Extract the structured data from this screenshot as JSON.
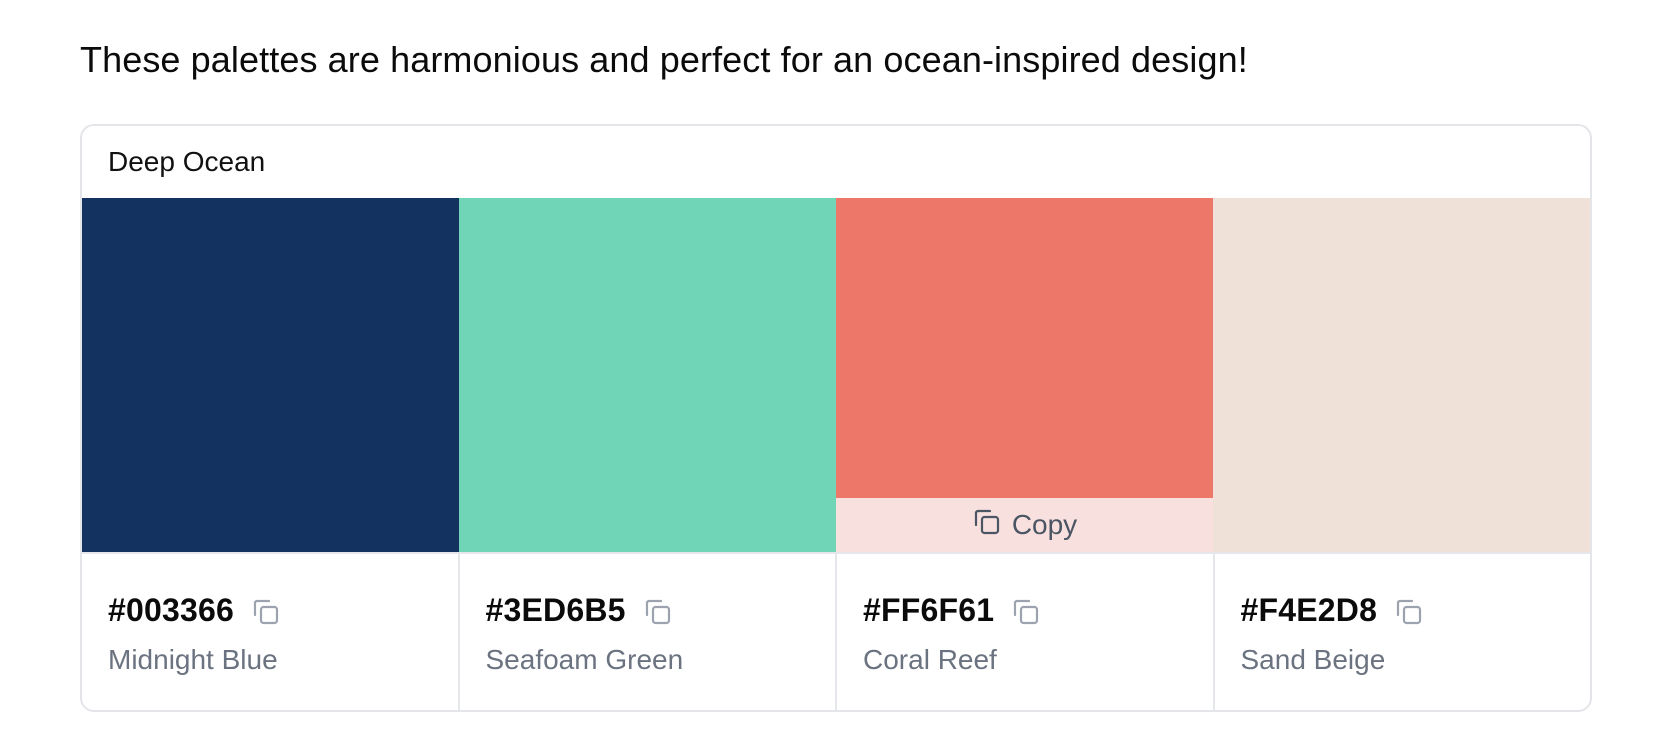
{
  "intro_text": "These palettes are harmonious and perfect for an ocean-inspired design!",
  "palette": {
    "title": "Deep Ocean",
    "copy_overlay_label": "Copy",
    "colors": [
      {
        "hex": "#003366",
        "name": "Midnight Blue",
        "swatch_color": "#133260"
      },
      {
        "hex": "#3ED6B5",
        "name": "Seafoam Green",
        "swatch_color": "#70D5B6"
      },
      {
        "hex": "#FF6F61",
        "name": "Coral Reef",
        "swatch_color": "#ED786A",
        "overlay_color": "#F7E0DE"
      },
      {
        "hex": "#F4E2D8",
        "name": "Sand Beige",
        "swatch_color": "#F0E1D8"
      }
    ]
  },
  "icons": {
    "copy": "copy-icon"
  }
}
